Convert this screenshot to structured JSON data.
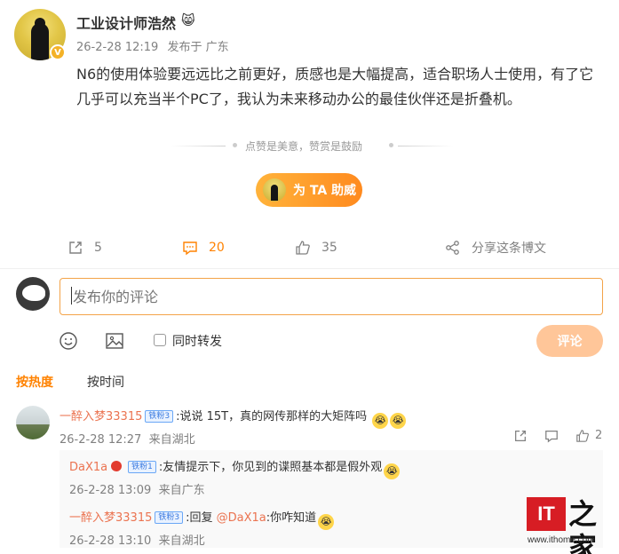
{
  "post": {
    "username": "工业设计师浩然",
    "username_emoji": "😸",
    "verified_badge": "V",
    "date": "26-2-28 12:19",
    "location": "发布于 广东",
    "content": "N6的使用体验要远远比之前更好，质感也是大幅提高，适合职场人士使用，有了它几乎可以充当半个PC了，我认为未来移动办公的最佳伙伴还是折叠机。",
    "reward_text": "点赞是美意，赞赏是鼓励",
    "help_button": "为 TA 助威"
  },
  "actions": {
    "repost_count": "5",
    "comment_count": "20",
    "like_count": "35",
    "share_label": "分享这条博文",
    "colors": {
      "active": "#ff8200",
      "default": "#808080"
    }
  },
  "composer": {
    "placeholder": "发布你的评论",
    "repost_label": "同时转发",
    "submit_label": "评论"
  },
  "sort": {
    "hot": "按热度",
    "time": "按时间"
  },
  "comments": [
    {
      "user": "一醉入梦33315",
      "badge": "铁粉3",
      "text": ":说说 15T，真的网传那样的大矩阵吗",
      "emojis": [
        "😭",
        "😭"
      ],
      "time": "26-2-28 12:27",
      "location": "来自湖北",
      "like_count": "2",
      "replies": [
        {
          "user": "DaX1a",
          "badge": "铁粉1",
          "text": ":友情提示下，你见到的谍照基本都是假外观",
          "emojis": [
            "😭"
          ],
          "time": "26-2-28 13:09",
          "location": "来自广东"
        },
        {
          "user": "一醉入梦33315",
          "badge": "铁粉3",
          "reply_prefix": ":回复",
          "mention": "@DaX1a",
          "text": ":你咋知道",
          "emojis": [
            "😭"
          ],
          "time": "26-2-28 13:10",
          "location": "来自湖北"
        }
      ]
    }
  ],
  "watermark": {
    "logo": "IT",
    "char": "之家",
    "url": "www.ithome.com"
  }
}
